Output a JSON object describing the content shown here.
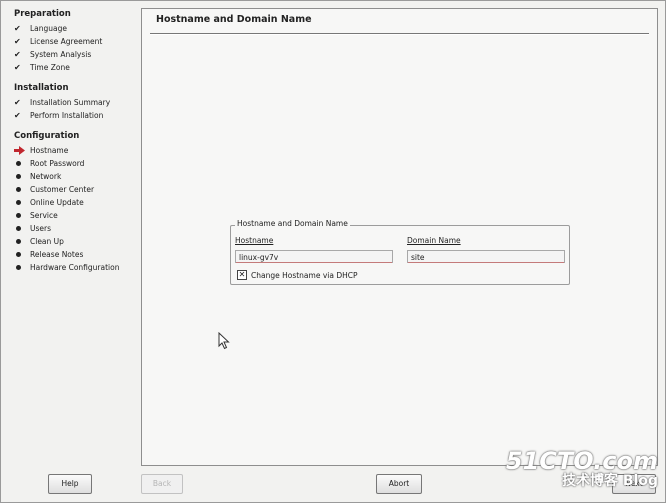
{
  "sidebar": {
    "preparation_title": "Preparation",
    "preparation_steps": [
      "Language",
      "License Agreement",
      "System Analysis",
      "Time Zone"
    ],
    "installation_title": "Installation",
    "installation_steps": [
      "Installation Summary",
      "Perform Installation"
    ],
    "configuration_title": "Configuration",
    "configuration_steps": [
      "Hostname",
      "Root Password",
      "Network",
      "Customer Center",
      "Online Update",
      "Service",
      "Users",
      "Clean Up",
      "Release Notes",
      "Hardware Configuration"
    ],
    "current_step": "Hostname"
  },
  "main": {
    "title": "Hostname and Domain Name",
    "group_title": "Hostname and Domain Name",
    "hostname_label": "Hostname",
    "hostname_value": "linux-gv7v",
    "domain_label": "Domain Name",
    "domain_value": "site",
    "dhcp_checkbox_label": "Change Hostname via DHCP",
    "dhcp_checked": true
  },
  "buttons": {
    "help": "Help",
    "back": "Back",
    "abort": "Abort",
    "next": "Next"
  },
  "watermark": {
    "site": "51CTO.com",
    "blog_cn": "技术博客",
    "blog_en": "Blog"
  },
  "colors": {
    "current_arrow": "#c0262d",
    "field_underline": "#c47a7a"
  }
}
